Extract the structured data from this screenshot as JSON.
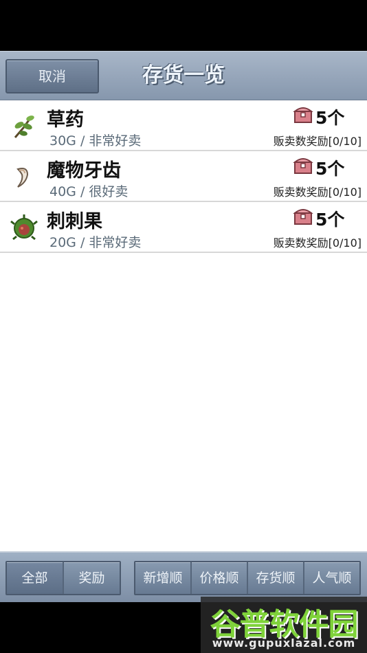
{
  "header": {
    "cancel_label": "取消",
    "title": "存货一览"
  },
  "items": [
    {
      "name": "草药",
      "sub": "30G / 非常好卖",
      "qty": "5个",
      "reward": "贩卖数奖励[0/10]",
      "icon": "herb-icon"
    },
    {
      "name": "魔物牙齿",
      "sub": "40G / 很好卖",
      "qty": "5个",
      "reward": "贩卖数奖励[0/10]",
      "icon": "fang-icon"
    },
    {
      "name": "刺刺果",
      "sub": "20G / 非常好卖",
      "qty": "5个",
      "reward": "贩卖数奖励[0/10]",
      "icon": "spiky-fruit-icon"
    }
  ],
  "filters": {
    "all": "全部",
    "reward": "奖励"
  },
  "sorts": {
    "newest": "新增顺",
    "price": "价格顺",
    "stock": "存货顺",
    "popularity": "人气顺"
  },
  "watermark": {
    "logo": "谷普软件园",
    "url": "www.gupuxlazal.com"
  },
  "colors": {
    "header_bg": "#8fa0b6",
    "list_bg": "#ffffff",
    "accent_green": "#7fd23a",
    "chest_red": "#c8646e"
  }
}
